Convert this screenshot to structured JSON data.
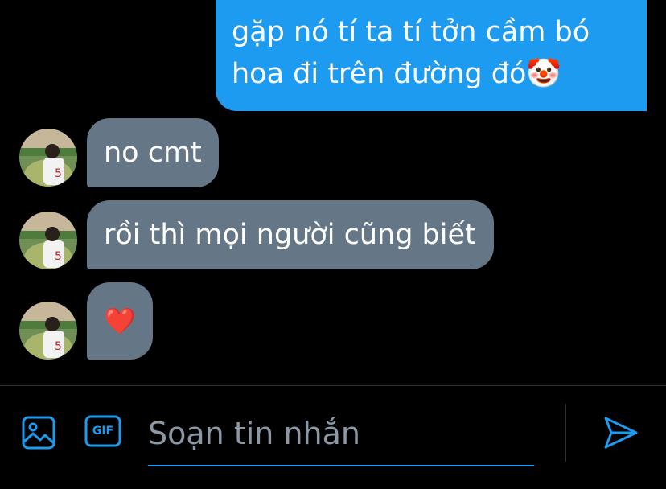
{
  "messages": [
    {
      "direction": "sent",
      "lines": [
        "gặp nó tí ta tí tởn cầm bó",
        "hoa đi trên đường đó🤡"
      ]
    },
    {
      "direction": "received",
      "text": "no cmt"
    },
    {
      "direction": "received",
      "text": "rồi thì mọi người cũng biết"
    },
    {
      "direction": "received",
      "text": "❤️"
    }
  ],
  "composer": {
    "placeholder": "Soạn tin nhắn",
    "icons": [
      "image-icon",
      "gif-icon",
      "send-icon"
    ],
    "gif_label": "GIF"
  },
  "colors": {
    "background": "#000000",
    "sent_bubble": "#1d9bf0",
    "received_bubble": "#657786",
    "accent": "#1d9bf0"
  }
}
